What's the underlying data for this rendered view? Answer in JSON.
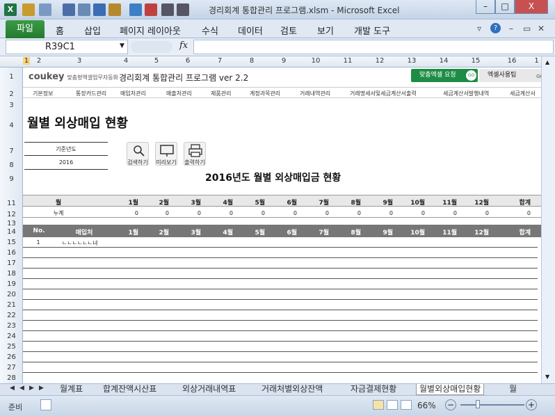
{
  "window": {
    "title": "경리회계 통합관리 프로그램.xlsm - Microsoft Excel",
    "min": "–",
    "max": "□",
    "close": "X"
  },
  "ribbon": {
    "file": "파일",
    "tabs": [
      "홈",
      "삽입",
      "페이지 레이아웃",
      "수식",
      "데이터",
      "검토",
      "보기",
      "개발 도구"
    ]
  },
  "formula": {
    "name_box": "R39C1",
    "fx": "fx",
    "value": ""
  },
  "columns": [
    "1",
    "2",
    "3",
    "4",
    "5",
    "6",
    "7",
    "8",
    "9",
    "10",
    "11",
    "12",
    "13",
    "14",
    "15",
    "16",
    "1"
  ],
  "rows": [
    "1",
    "2",
    "3",
    "4",
    "7",
    "8",
    "9",
    "11",
    "12",
    "13",
    "14",
    "15",
    "16",
    "17",
    "18",
    "19",
    "20",
    "21",
    "22",
    "23",
    "24",
    "25",
    "26",
    "27",
    "28"
  ],
  "sheet": {
    "brand": "coukey",
    "brand_sub": "맞춤형엑셀업무자동화",
    "app_title": "경리회계 통합관리 프로그램 ver 2.2",
    "btn_request": "맞춤엑셀 요청",
    "btn_request_go": "GO",
    "btn_usage": "엑셀사용팁",
    "btn_usage_go": "GO",
    "nav": [
      "기본정보",
      "통장카드관리",
      "매입처관리",
      "매출처관리",
      "제품관리",
      "계정과목관리",
      "거래내역관리",
      "거래명세서및세금계산서출력",
      "세금계산서발행내역",
      "세금계산서"
    ],
    "page_title": "월별 외상매입 현황",
    "base_year_label": "기준년도",
    "base_year": "2016",
    "buttons": {
      "search": "검색하기",
      "preview": "미리보기",
      "print": "출력하기"
    },
    "report_title": "2016년도 월별 외상매입금 현황",
    "month_header": "월",
    "cumulative_label": "누계",
    "months": [
      "1월",
      "2월",
      "3월",
      "4월",
      "5월",
      "6월",
      "7월",
      "8월",
      "9월",
      "10월",
      "11월",
      "12월"
    ],
    "total": "합계",
    "cumulative_values": [
      "0",
      "0",
      "0",
      "0",
      "0",
      "0",
      "0",
      "0",
      "0",
      "0",
      "0",
      "0",
      "0"
    ],
    "no_header": "No.",
    "vendor_header": "매입처",
    "records": [
      {
        "no": "1",
        "vendor": "ㄴㄴㄴㄴㄴㄴ녀"
      }
    ]
  },
  "sheet_tabs": [
    "월계표",
    "합계잔액시산표",
    "외상거래내역표",
    "거래처별외상잔액",
    "자금결제현황",
    "월별외상매입현황",
    "월"
  ],
  "status": {
    "ready": "준비",
    "zoom": "66%",
    "minus": "−",
    "plus": "+"
  }
}
